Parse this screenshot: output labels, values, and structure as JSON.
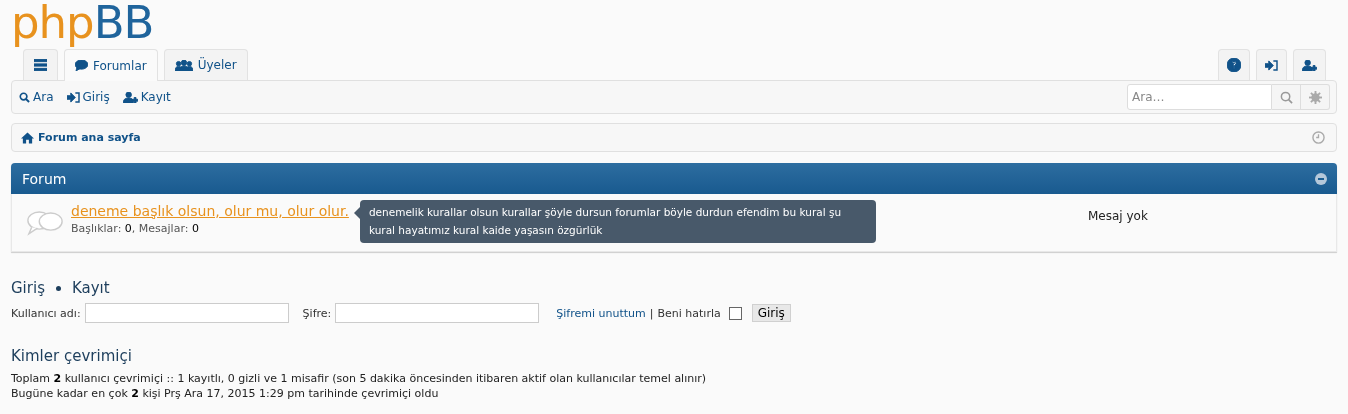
{
  "logo": [
    {
      "text": "php",
      "color": "#e8921e"
    },
    {
      "text": "BB",
      "color": "#1f649c"
    }
  ],
  "tabs": [
    {
      "kind": "menu",
      "selected": false
    },
    {
      "kind": "forums",
      "label": "Forumlar",
      "selected": true
    },
    {
      "kind": "members",
      "label": "Üyeler",
      "selected": false
    }
  ],
  "quick_tabs": [
    {
      "kind": "help",
      "selected": false
    },
    {
      "kind": "login",
      "selected": false
    },
    {
      "kind": "register",
      "selected": false
    }
  ],
  "nav_links": [
    {
      "kind": "search",
      "label": "Ara"
    },
    {
      "kind": "login",
      "label": "Giriş"
    },
    {
      "kind": "register",
      "label": "Kayıt"
    }
  ],
  "search": {
    "placeholder": "Ara…"
  },
  "breadcrumb": "Forum ana sayfa",
  "forum_section": {
    "title": "Forum",
    "forums": [
      {
        "title": "deneme başlık olsun, olur mu, olur olur.",
        "stats": "Başlıklar: **0**, Mesajlar: **0**",
        "last_post": "Mesaj yok",
        "tooltip": "denemelik kurallar olsun kurallar şöyle dursun forumlar böyle durdun efendim bu kural şu kural hayatımız kural kaide yaşasın özgürlük"
      }
    ]
  },
  "login": {
    "heading_links": [
      "Giriş",
      "Kayıt"
    ],
    "username_label": "Kullanıcı adı:",
    "password_label": "Şifre:",
    "forgot": "Şifremi unuttum",
    "separator": "|",
    "remember_label": "Beni hatırla",
    "remember": false,
    "button": "Giriş"
  },
  "online": {
    "heading": "Kimler çevrimiçi",
    "lines": [
      "Toplam **2** kullanıcı çevrimiçi :: 1 kayıtlı, 0 gizli ve 1 misafir (son 5 dakika öncesinden itibaren aktif olan kullanıcılar temel alınır)",
      "Bugüne kadar en çok **2** kişi Prş Ara 17, 2015 1:29 pm tarihinde çevrimiçi oldu"
    ]
  }
}
